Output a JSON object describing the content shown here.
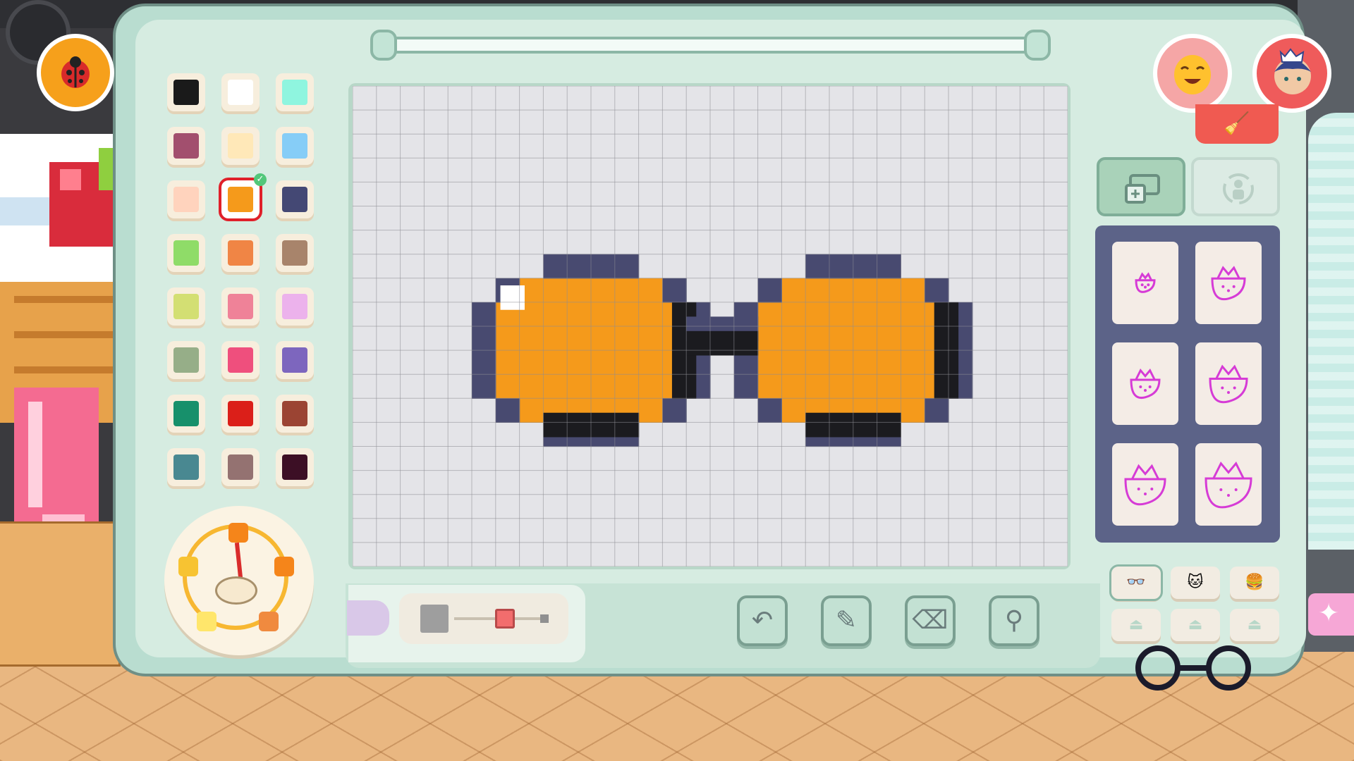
{
  "palette": {
    "swatches": [
      {
        "color": "#1a1a1a"
      },
      {
        "color": "#ffffff"
      },
      {
        "color": "#8ff5df"
      },
      {
        "color": "#a24f6e"
      },
      {
        "color": "#ffe8b8"
      },
      {
        "color": "#86cdf7"
      },
      {
        "color": "#ffd3bd"
      },
      {
        "color": "#f59a1b",
        "selected": true
      },
      {
        "color": "#444874"
      },
      {
        "color": "#8fdc68"
      },
      {
        "color": "#f08545"
      },
      {
        "color": "#a8846b"
      },
      {
        "color": "#d3df73"
      },
      {
        "color": "#ef8298"
      },
      {
        "color": "#ecb2ec"
      },
      {
        "color": "#96ae88"
      },
      {
        "color": "#ef4f7d"
      },
      {
        "color": "#7d66be"
      },
      {
        "color": "#17906b"
      },
      {
        "color": "#db1f19"
      },
      {
        "color": "#9b4433"
      },
      {
        "color": "#498891"
      },
      {
        "color": "#947271"
      },
      {
        "color": "#3c0f25"
      }
    ]
  },
  "drawing": {
    "grid_cols": 30,
    "grid_rows": 20,
    "lens_color": "#f59a1b",
    "frame_color": "#484a70",
    "shadow_color": "#1b1b1f",
    "highlight_color": "#ffffff",
    "grid_line_color": "#8e8e94",
    "bg_color": "#e4e4e8"
  },
  "brush_size_slider": {
    "value_fraction": 0.55
  },
  "tools": [
    {
      "name": "undo",
      "icon": "undo-icon",
      "glyph": "↶"
    },
    {
      "name": "brush",
      "icon": "brush-icon",
      "glyph": "✎"
    },
    {
      "name": "eraser",
      "icon": "eraser-icon",
      "glyph": "⌫"
    },
    {
      "name": "eyedropper",
      "icon": "eyedropper-icon",
      "glyph": "⚲"
    }
  ],
  "variants": [
    {
      "icon": "strawberry-icon"
    },
    {
      "icon": "strawberry-icon"
    },
    {
      "icon": "strawberry-icon"
    },
    {
      "icon": "strawberry-icon"
    },
    {
      "icon": "strawberry-icon"
    },
    {
      "icon": "strawberry-icon"
    }
  ],
  "slots": [
    {
      "icon": "glasses-icon",
      "glyph": "👓"
    },
    {
      "icon": "cat-icon",
      "glyph": "🐱"
    },
    {
      "icon": "burger-icon",
      "glyph": "🍔"
    },
    {
      "icon": "empty-slot-icon",
      "glyph": "⏏"
    },
    {
      "icon": "empty-slot-icon",
      "glyph": "⏏"
    },
    {
      "icon": "empty-slot-icon",
      "glyph": "⏏"
    }
  ]
}
